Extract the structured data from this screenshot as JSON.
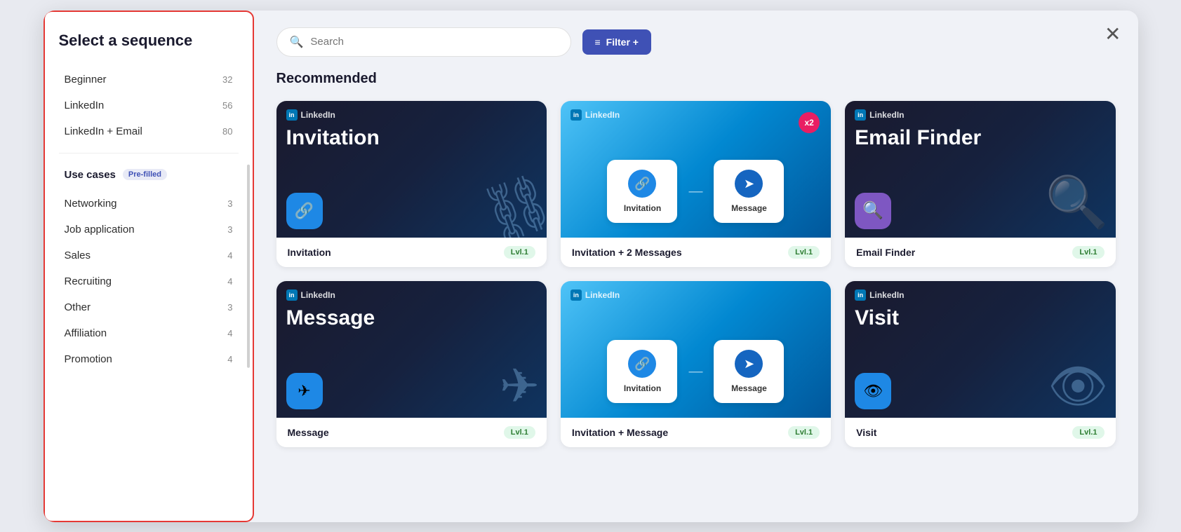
{
  "modal": {
    "close_label": "✕"
  },
  "sidebar": {
    "title": "Select a sequence",
    "top_items": [
      {
        "label": "Beginner",
        "count": "32"
      },
      {
        "label": "LinkedIn",
        "count": "56"
      },
      {
        "label": "LinkedIn + Email",
        "count": "80"
      }
    ],
    "use_cases_label": "Use cases",
    "pre_filled_badge": "Pre-filled",
    "use_case_items": [
      {
        "label": "Networking",
        "count": "3"
      },
      {
        "label": "Job application",
        "count": "3"
      },
      {
        "label": "Sales",
        "count": "4"
      },
      {
        "label": "Recruiting",
        "count": "4"
      },
      {
        "label": "Other",
        "count": "3"
      },
      {
        "label": "Affiliation",
        "count": "4"
      },
      {
        "label": "Promotion",
        "count": "4"
      }
    ]
  },
  "search": {
    "placeholder": "Search"
  },
  "filter_btn": {
    "label": "Filter +"
  },
  "recommended_section": {
    "title": "Recommended"
  },
  "cards": [
    {
      "id": "invitation",
      "type": "dark",
      "platform": "LinkedIn",
      "title": "Invitation",
      "footer_name": "Invitation",
      "level": "Lvl.1"
    },
    {
      "id": "invitation-2-messages",
      "type": "blue_flow",
      "platform": "LinkedIn",
      "title": "",
      "footer_name": "Invitation + 2 Messages",
      "level": "Lvl.1",
      "x2": true,
      "nodes": [
        {
          "label": "Invitation",
          "icon": "🔗"
        },
        {
          "label": "Message",
          "icon": "➤"
        }
      ]
    },
    {
      "id": "email-finder",
      "type": "dark_search",
      "platform": "LinkedIn",
      "title": "Email Finder",
      "footer_name": "Email Finder",
      "level": "Lvl.1"
    },
    {
      "id": "message",
      "type": "dark_plane",
      "platform": "LinkedIn",
      "title": "Message",
      "footer_name": "Message",
      "level": "Lvl.1"
    },
    {
      "id": "invitation-message",
      "type": "blue_flow2",
      "platform": "LinkedIn",
      "title": "",
      "footer_name": "Invitation + Message",
      "level": "Lvl.1",
      "nodes": [
        {
          "label": "Invitation",
          "icon": "🔗"
        },
        {
          "label": "Message",
          "icon": "➤"
        }
      ]
    },
    {
      "id": "visit",
      "type": "dark_eye",
      "platform": "LinkedIn",
      "title": "Visit",
      "footer_name": "Visit",
      "level": "Lvl.1"
    }
  ],
  "icons": {
    "search": "🔍",
    "filter": "≡",
    "linkedin": "in",
    "link": "🔗",
    "message": "➤",
    "search_mag": "🔍",
    "plane": "✈",
    "eye": "👁"
  }
}
